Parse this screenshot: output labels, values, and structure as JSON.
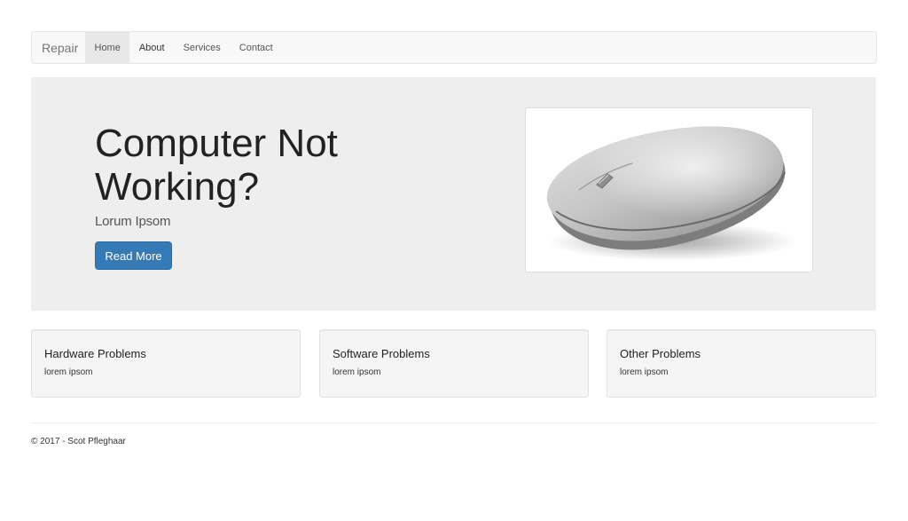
{
  "navbar": {
    "brand": "Repair",
    "items": [
      {
        "label": "Home"
      },
      {
        "label": "About"
      },
      {
        "label": "Services"
      },
      {
        "label": "Contact"
      }
    ]
  },
  "hero": {
    "title": "Computer Not Working?",
    "subtitle": "Lorum Ipsom",
    "button_label": "Read More",
    "image": "computer-mouse"
  },
  "cards": [
    {
      "title": "Hardware Problems",
      "text": "lorem ipsom"
    },
    {
      "title": "Software Problems",
      "text": "lorem ipsom"
    },
    {
      "title": "Other Problems",
      "text": "lorem ipsom"
    }
  ],
  "footer": {
    "text": "© 2017 - Scot Pfleghaar"
  },
  "colors": {
    "primary_button": "#337ab7",
    "jumbotron_bg": "#eeeeee",
    "navbar_bg": "#f8f8f8"
  }
}
